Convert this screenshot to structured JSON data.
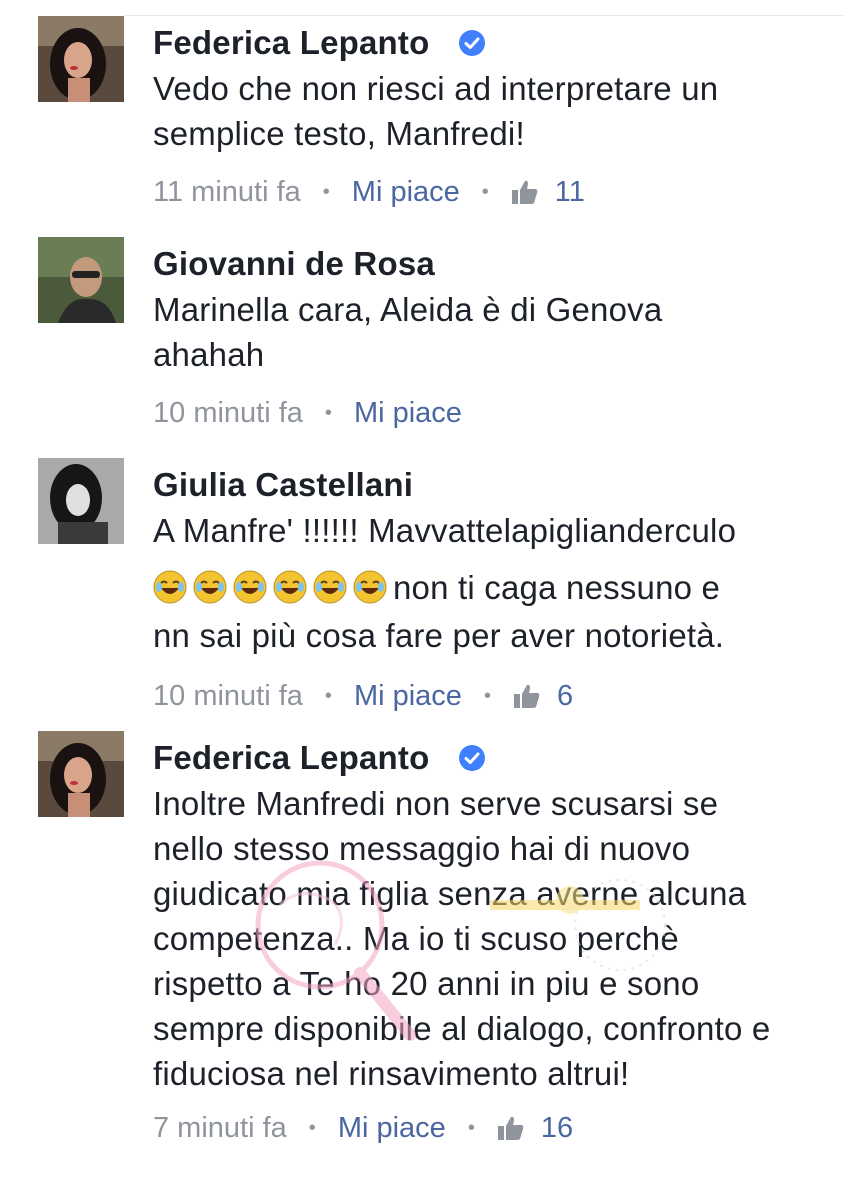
{
  "comments": [
    {
      "author": "Federica Lepanto",
      "verified": true,
      "text": "Vedo che non riesci ad interpretare un semplice testo, Manfredi!",
      "time": "11 minuti fa",
      "like_label": "Mi piace",
      "likes": "11",
      "avatar_icon": "avatar-woman-dark-hair"
    },
    {
      "author": "Giovanni de Rosa",
      "verified": false,
      "text": "Marinella cara, Aleida è di Genova ahahah",
      "time": "10 minuti fa",
      "like_label": "Mi piace",
      "likes": "",
      "avatar_icon": "avatar-man-sunglasses"
    },
    {
      "author": "Giulia Castellani",
      "verified": false,
      "text_line1": "A Manfre' !!!!!! Mavvattelapiglianderculo",
      "text_line2": " non ti caga nessuno e",
      "text_line3": "nn sai più cosa fare per aver notorietà.",
      "emoji": "😂😂😂😂😂😂",
      "time": "10 minuti fa",
      "like_label": "Mi piace",
      "likes": "6",
      "avatar_icon": "avatar-woman-black-white"
    },
    {
      "author": "Federica Lepanto",
      "verified": true,
      "text": "Inoltre Manfredi non serve scusarsi se nello stesso messaggio hai di nuovo giudicato mia figlia senza averne alcuna competenza.. Ma io ti scuso perchè rispetto a Te ho 20 anni in piu e sono sempre disponibile al dialogo, confronto e fiduciosa nel rinsavimento altrui!",
      "time": "7 minuti fa",
      "like_label": "Mi piace",
      "likes": "16",
      "avatar_icon": "avatar-woman-dark-hair"
    }
  ],
  "colors": {
    "text": "#1d2129",
    "meta_gray": "#90949c",
    "link_blue": "#4b67a1",
    "verified_blue": "#4080ff"
  }
}
